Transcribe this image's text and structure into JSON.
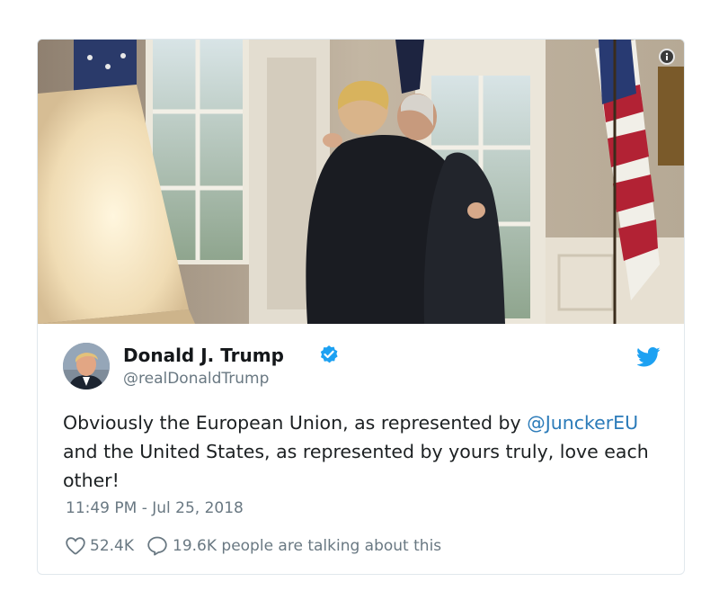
{
  "tweet": {
    "author_name": "Donald J. Trump",
    "author_handle": "@realDonaldTrump",
    "text_before": "Obviously the European Union, as represented by ",
    "mention": "@JunckerEU",
    "text_after": " and the United States, as represented by yours truly, love each other!",
    "timestamp": "11:49 PM - Jul 25, 2018",
    "likes": "52.4K",
    "talking": "19.6K people are talking about this"
  },
  "colors": {
    "link": "#2b7bb9",
    "twitter_blue": "#1da1f2",
    "secondary_text": "#697882",
    "primary_text": "#1c2022"
  },
  "icons": {
    "info": "info-icon",
    "verified": "verified-badge-icon",
    "brand": "twitter-bird-icon",
    "like": "heart-icon",
    "reply": "speech-bubble-icon"
  }
}
